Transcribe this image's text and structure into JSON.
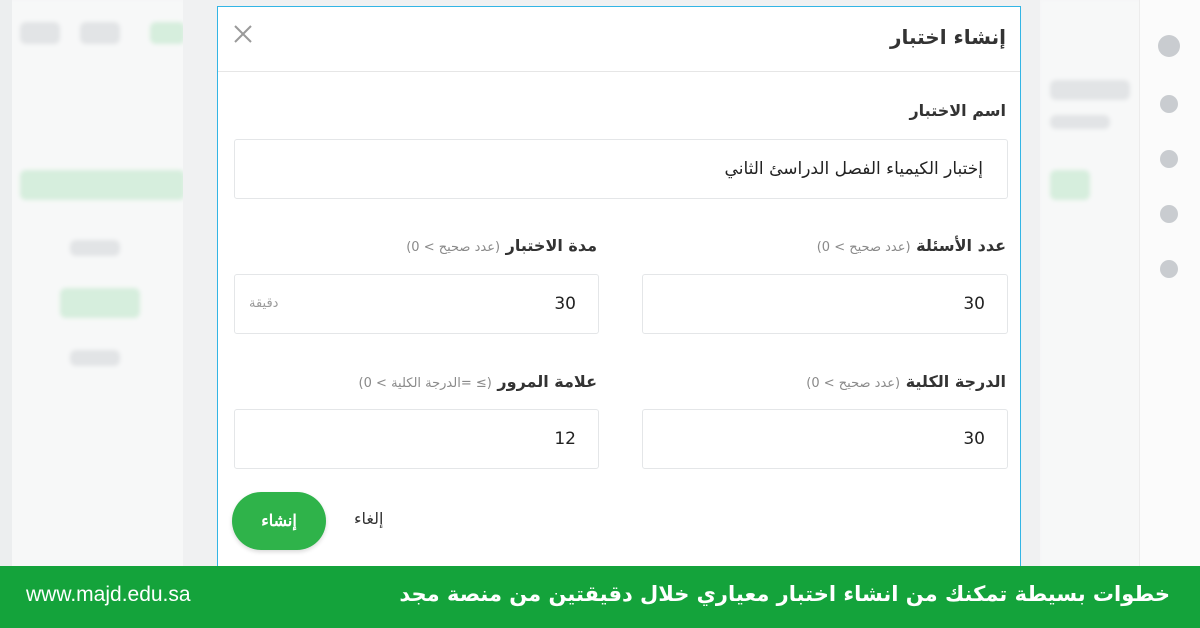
{
  "dialog": {
    "title": "إنشاء اختبار",
    "close_icon": "close-icon",
    "test_name": {
      "label": "اسم الاختبار",
      "value": "إختبار الكيمياء الفصل الدراسئ الثاني"
    },
    "questions_count": {
      "label": "عدد الأسئلة",
      "hint": "(عدد صحيح > 0)",
      "value": "30"
    },
    "duration": {
      "label": "مدة الاختبار",
      "hint": "(عدد صحيح > 0)",
      "value": "30",
      "suffix": "دقيقة"
    },
    "total_grade": {
      "label": "الدرجة الكلية",
      "hint": "(عدد صحيح > 0)",
      "value": "30"
    },
    "pass_mark": {
      "label": "علامة المرور",
      "hint": "(≥ =الدرجة الكلية > 0)",
      "value": "12"
    },
    "create_label": "إنشاء",
    "cancel_label": "إلغاء"
  },
  "banner": {
    "url": "www.majd.edu.sa",
    "text": "خطوات بسيطة تمكنك من انشاء اختبار معياري خلال دقيقتين من منصة مجد",
    "color": "#14a33b"
  },
  "colors": {
    "accent": "#2fb34a",
    "dialog_border": "#33b5e5"
  }
}
